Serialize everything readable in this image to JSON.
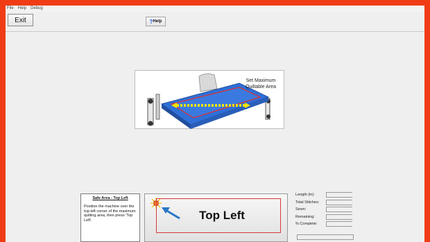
{
  "menu": [
    "File",
    "Help",
    "Debug"
  ],
  "toolbar": {
    "exit_label": "Exit",
    "help_label": "Help",
    "help_glyph": "?"
  },
  "illustration": {
    "caption_line1": "Set Maximum",
    "caption_line2": "Quiltable Area"
  },
  "instructions": {
    "title": "Safe Area - Top Left",
    "body": "Position the machine over the top-left corner of the maximum quilting area, then press 'Top Left'."
  },
  "main_button": {
    "label": "Top Left",
    "icon": "arrow-to-corner-icon"
  },
  "stats": [
    {
      "label": "Length (in):",
      "value": ""
    },
    {
      "label": "Total Stitches:",
      "value": ""
    },
    {
      "label": "Sewn:",
      "value": ""
    },
    {
      "label": "Remaining:",
      "value": ""
    },
    {
      "label": "% Complete:",
      "value": ""
    }
  ],
  "colors": {
    "border": "#f03c14",
    "accent_red": "#d83a3a",
    "frame_blue": "#2f6fd8",
    "arrow_blue": "#2a78c8"
  }
}
